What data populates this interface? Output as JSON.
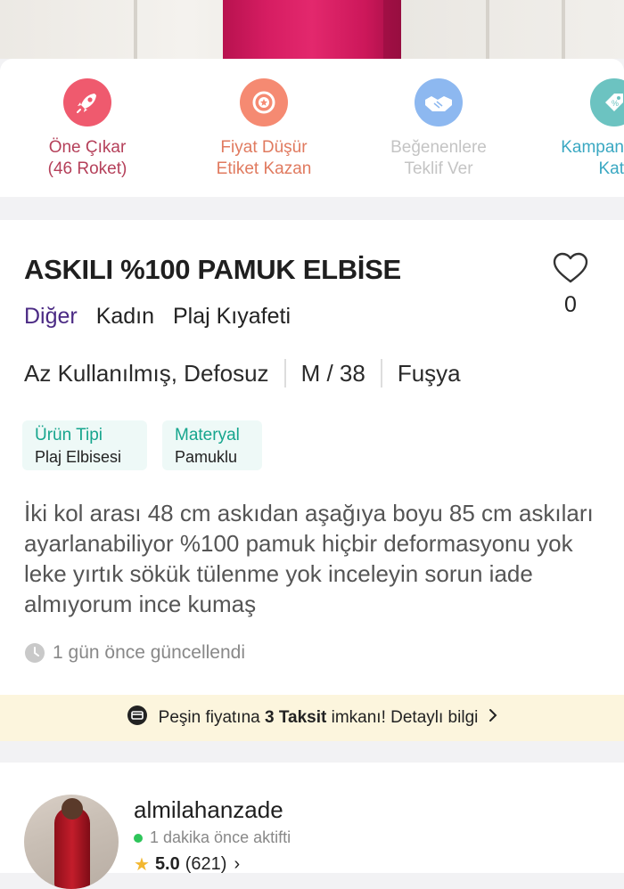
{
  "actions": [
    {
      "line1": "Öne Çıkar",
      "line2": "(46 Roket)",
      "icon": "rocket-icon",
      "color": "#ef5a6e",
      "text_color": "#b5405a"
    },
    {
      "line1": "Fiyat Düşür",
      "line2": "Etiket Kazan",
      "icon": "badge-icon",
      "color": "#f58a72",
      "text_color": "#e07a5f"
    },
    {
      "line1": "Beğenenlere",
      "line2": "Teklif Ver",
      "icon": "handshake-icon",
      "color": "#8db8f0",
      "text_color": "#bdbdbd"
    },
    {
      "line1": "Kampan",
      "line2": "Kat",
      "icon": "tag-icon",
      "color": "#6cc3c1",
      "text_color": "#3aa8c2"
    }
  ],
  "product": {
    "title": "ASKILI %100 PAMUK ELBİSE",
    "like_count": "0",
    "categories": [
      "Diğer",
      "Kadın",
      "Plaj Kıyafeti"
    ],
    "condition": "Az Kullanılmış, Defosuz",
    "size": "M / 38",
    "color": "Fuşya",
    "tags": [
      {
        "label": "Ürün Tipi",
        "value": "Plaj Elbisesi"
      },
      {
        "label": "Materyal",
        "value": "Pamuklu"
      }
    ],
    "description": "İki kol arası 48 cm askıdan aşağıya boyu 85 cm askıları ayarlanabiliyor %100 pamuk hiçbir deformasyonu yok leke yırtık sökük tülenme yok inceleyin sorun iade almıyorum ince kumaş",
    "updated": "1 gün önce güncellendi"
  },
  "banner": {
    "before": "Peşin fiyatına ",
    "bold": "3 Taksit",
    "after": " imkanı! Detaylı bilgi"
  },
  "seller": {
    "username": "almilahanzade",
    "status": "1 dakika önce aktifti",
    "rating": "5.0",
    "review_count": "(621)"
  },
  "colors": {
    "accent_green": "#16a58d",
    "category_purple": "#4b2a84",
    "banner_bg": "#fcf5dd"
  }
}
